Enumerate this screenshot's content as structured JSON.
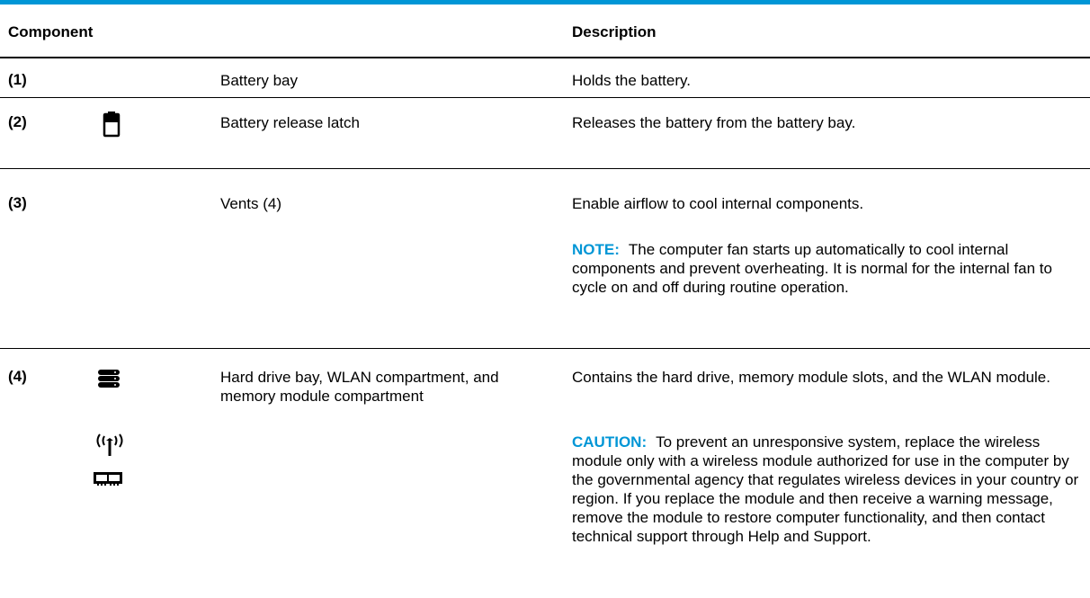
{
  "header": {
    "component": "Component",
    "description": "Description"
  },
  "rows": [
    {
      "number": "(1)",
      "name": "Battery bay",
      "description": "Holds the battery.",
      "icons": []
    },
    {
      "number": "(2)",
      "name": "Battery release latch",
      "description": "Releases the battery from the battery bay.",
      "icons": [
        "battery-icon"
      ]
    },
    {
      "number": "(3)",
      "name": "Vents (4)",
      "description": "Enable airflow to cool internal components.",
      "note_label": "NOTE:",
      "note_text": "The computer fan starts up automatically to cool internal components and prevent overheating. It is normal for the internal fan to cycle on and off during routine operation.",
      "icons": []
    },
    {
      "number": "(4)",
      "name": "Hard drive bay, WLAN compartment, and memory module compartment",
      "description": "Contains the hard drive, memory module slots, and the WLAN module.",
      "note_label": "CAUTION:",
      "note_text": "To prevent an unresponsive system, replace the wireless module only with a wireless module authorized for use in the computer by the governmental agency that regulates wireless devices in your country or region. If you replace the module and then receive a warning message, remove the module to restore computer functionality, and then contact technical support through Help and Support.",
      "icons": [
        "hard-drive-icon",
        "wireless-antenna-icon",
        "memory-module-icon"
      ]
    }
  ],
  "colors": {
    "accent": "#0096d6",
    "rule": "#000000"
  }
}
